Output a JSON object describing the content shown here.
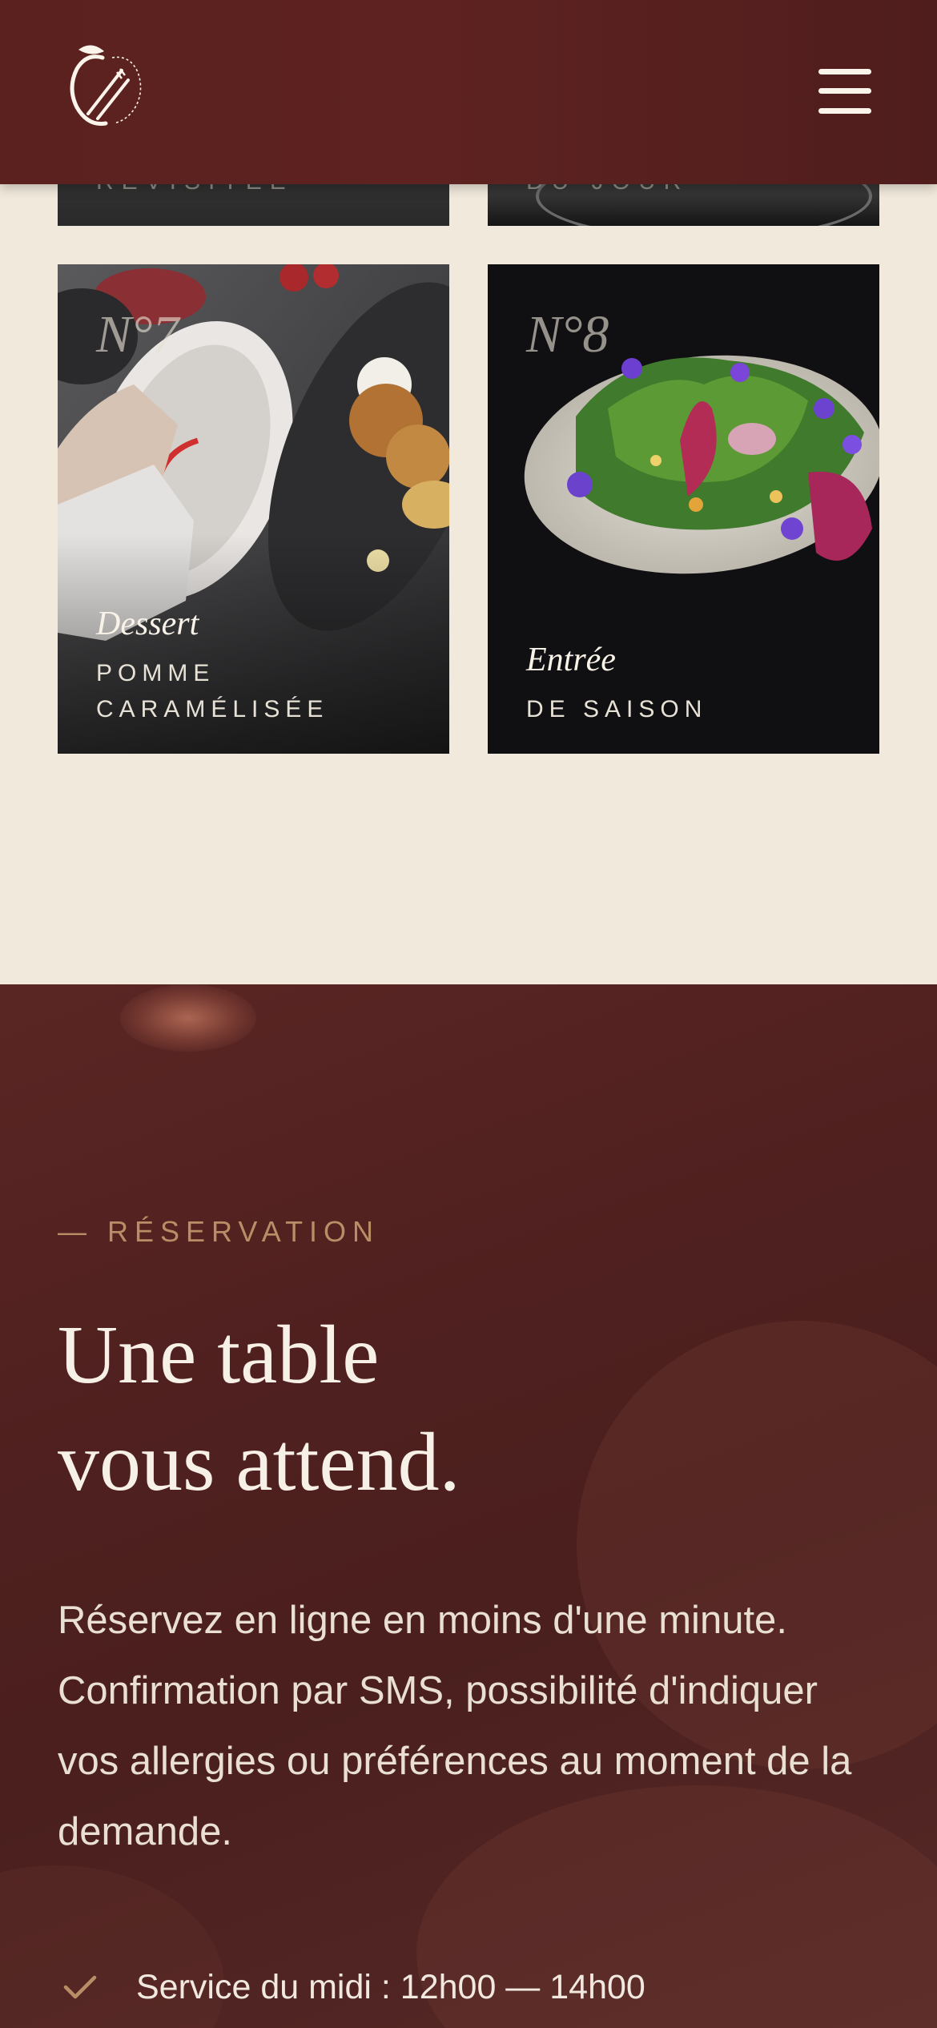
{
  "header": {
    "logo_icon": "apple-cutlery-logo-icon",
    "menu_icon": "hamburger-menu-icon"
  },
  "cards": [
    {
      "label": "REVISITÉE"
    },
    {
      "label": "DU JOUR"
    },
    {
      "number": "N°7",
      "kind": "Dessert",
      "name": "POMME CARAMÉLISÉE"
    },
    {
      "number": "N°8",
      "kind": "Entrée",
      "name": "DE SAISON"
    }
  ],
  "reservation": {
    "eyebrow": "— RÉSERVATION",
    "title_line1": "Une table",
    "title_line2": "vous attend.",
    "lead": "Réservez en ligne en moins d'une minute. Confirmation par SMS, possibilité d'indiquer vos allergies ou préférences au moment de la demande.",
    "services": [
      {
        "icon": "check-icon",
        "text": "Service du midi : 12h00 — 14h00"
      }
    ]
  },
  "colors": {
    "cream": "#f1e9db",
    "burgundy": "#5a211f",
    "gold": "#b98e67"
  }
}
